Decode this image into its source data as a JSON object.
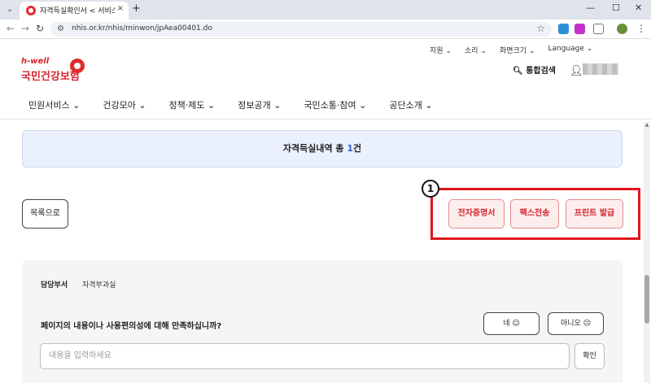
{
  "browser": {
    "tab_title": "자격득실확인서 < 서비스찾기",
    "tab_close": "×",
    "new_tab": "+",
    "url": "nhis.or.kr/nhis/minwon/jpAea00401.do",
    "window_controls": [
      "—",
      "☐",
      "✕"
    ]
  },
  "header": {
    "util_links": [
      "지원 ⌄",
      "소리 ⌄",
      "화면크기 ⌄",
      "Language ⌄"
    ],
    "logo_hwell": "h-well",
    "logo_name": "국민건강보험",
    "search_label": "통합검색"
  },
  "gnb": {
    "items": [
      "민원서비스 ⌄",
      "건강모아 ⌄",
      "정책·제도 ⌄",
      "정보공개 ⌄",
      "국민소통·참여 ⌄",
      "공단소개 ⌄"
    ]
  },
  "summary": {
    "prefix": "자격득실내역 총 ",
    "count": "1",
    "suffix": "건"
  },
  "actions": {
    "list_button": "목록으로",
    "callout_number": "1",
    "electronic_cert": "전자증명서",
    "fax_send": "팩스전송",
    "print_issue": "프린트 발급"
  },
  "feedback": {
    "dept_label": "담당부서",
    "dept_value": "자격부과실",
    "question": "페이지의 내용이나 사용편의성에 대해 만족하십니까?",
    "yes": "네 ☺",
    "no": "아니오 ☹",
    "input_placeholder": "내용을 입력하세요",
    "confirm": "확인"
  },
  "colors": {
    "brand_red": "#d7262e",
    "highlight_red": "#e0161d",
    "count_blue": "#2b5fd6"
  }
}
